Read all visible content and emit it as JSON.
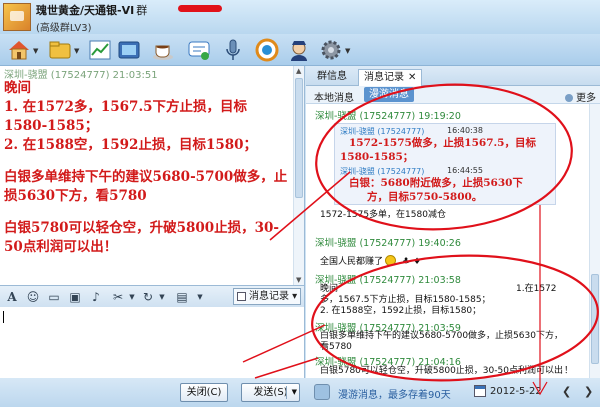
{
  "window": {
    "title": "瑰世黄金/天通银-VI",
    "title_level": "群",
    "subtitle": "(高级群LV3)"
  },
  "toolbar": {
    "icons": [
      "home-icon",
      "folder-icon",
      "chart-icon",
      "video-icon",
      "coffee-icon",
      "message-icon",
      "microphone-icon",
      "app-s-icon",
      "police-icon",
      "gear-icon"
    ]
  },
  "chat": {
    "header": "深圳-骁盟 (17524777)  21:03:51",
    "messages": [
      "晚间",
      "1. 在1572多，1567.5下方止损，目标1580-1585；",
      "2. 在1588空，1592止损，目标1580；",
      "白银多单维持下午的建议5680-5700做多，止损5630下方，看5780",
      "白银5780可以轻仓空，升破5800止损，30-50点利润可以出！"
    ]
  },
  "input_toolbar": {
    "history_label": "消息记录",
    "icons": [
      "font-icon",
      "smiley-icon",
      "folder-icon",
      "image-icon",
      "music-icon",
      "scissors-icon",
      "refresh-icon",
      "picture-icon"
    ]
  },
  "buttons": {
    "close": "关闭(C)",
    "send": "发送(S)"
  },
  "panel": {
    "tabs": [
      "群信息",
      "消息记录"
    ],
    "local_label": "本地消息",
    "roam_label": "漫游消息",
    "more_label": "更多",
    "messages": [
      {
        "sender": "深圳-骁盟 (17524777)  19:19:20"
      },
      {
        "quote_sender_1": "深圳-骁盟 (17524777)",
        "quote_time_1": "16:40:38",
        "quote_line_1": "1572-1575做多，止损1567.5，目标",
        "quote_line_2": "1580-1585；",
        "quote_sender_2": "深圳-骁盟 (17524777)",
        "quote_time_2": "16:44:55",
        "quote_line_3": "白银：5680附近做多，止损5630下",
        "quote_line_4": "方，目标5750-5800。"
      },
      {
        "body": "1572-1575多单，在1580减仓"
      },
      {
        "sender": "深圳-骁盟 (17524777)  19:40:26"
      },
      {
        "body": "全国人民都赚了"
      },
      {
        "sender": "深圳-骁盟 (17524777)  21:03:58"
      },
      {
        "body_1": "晚间",
        "body_2": "1.在1572",
        "body_3": "多，1567.5下方止损，目标1580-1585；",
        "body_4": "2. 在1588空，1592止损，目标1580；"
      },
      {
        "sender": "深圳-骁盟 (17524777)  21:03:59"
      },
      {
        "body_1": "白银多单维持下午的建议5680-5700做多，止损5630下方，",
        "body_2": "看5780"
      },
      {
        "sender": "深圳-骁盟 (17524777)  21:04:16"
      },
      {
        "body_1": "白银5780可以轻仓空，升破5800止损，30-50点利润可以出",
        "body_2": "！"
      }
    ],
    "roam_notice": "漫游消息，最多存着90天",
    "date": "2012-5-22"
  }
}
